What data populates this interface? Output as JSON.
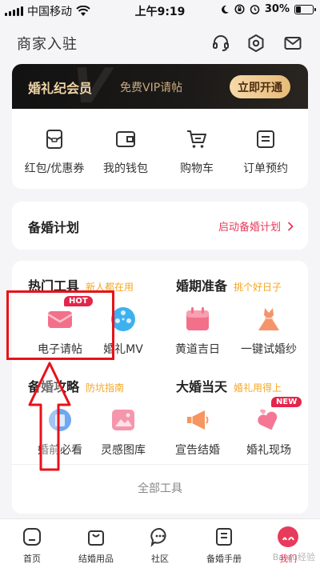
{
  "status_bar": {
    "carrier": "中国移动",
    "time": "上午9:19",
    "battery": "30%",
    "battery_level": 0.3
  },
  "header": {
    "title": "商家入驻",
    "icons": [
      "headset-icon",
      "gear-icon",
      "mail-icon"
    ]
  },
  "vip": {
    "title": "婚礼纪会员",
    "subtitle": "免费VIP请帖",
    "button": "立即开通"
  },
  "quick_links": [
    {
      "label": "红包/优惠券",
      "icon": "coupon-icon"
    },
    {
      "label": "我的钱包",
      "icon": "wallet-icon"
    },
    {
      "label": "购物车",
      "icon": "cart-icon"
    },
    {
      "label": "订单预约",
      "icon": "order-icon"
    }
  ],
  "plan": {
    "title": "备婚计划",
    "link": "启动备婚计划"
  },
  "sections": [
    {
      "title": "热门工具",
      "tag": "新人都在用"
    },
    {
      "title": "婚期准备",
      "tag": "挑个好日子"
    },
    {
      "title": "备婚攻略",
      "tag": "防坑指南"
    },
    {
      "title": "大婚当天",
      "tag": "婚礼用得上"
    }
  ],
  "tools": [
    {
      "label": "电子请帖",
      "icon": "envelope-icon",
      "badge": "HOT"
    },
    {
      "label": "婚礼MV",
      "icon": "film-reel-icon"
    },
    {
      "label": "黄道吉日",
      "icon": "calendar-icon"
    },
    {
      "label": "一键试婚纱",
      "icon": "wedding-dress-icon"
    },
    {
      "label": "婚前必看",
      "icon": "book-icon"
    },
    {
      "label": "灵感图库",
      "icon": "image-icon"
    },
    {
      "label": "宣告结婚",
      "icon": "megaphone-icon"
    },
    {
      "label": "婚礼现场",
      "icon": "hearts-icon",
      "badge": "NEW"
    }
  ],
  "all_tools": "全部工具",
  "tabs": [
    {
      "label": "首页",
      "icon": "home-icon"
    },
    {
      "label": "结婚用品",
      "icon": "shopping-bag-icon"
    },
    {
      "label": "社区",
      "icon": "chat-icon"
    },
    {
      "label": "备婚手册",
      "icon": "notebook-icon"
    },
    {
      "label": "我们",
      "icon": "couple-avatar-icon",
      "active": true
    }
  ],
  "watermark": "Baidu经验",
  "colors": {
    "accent": "#e83a5b",
    "tag": "#f5a623",
    "highlight": "#e8121a",
    "vip_gold": "#f1d4a6"
  }
}
